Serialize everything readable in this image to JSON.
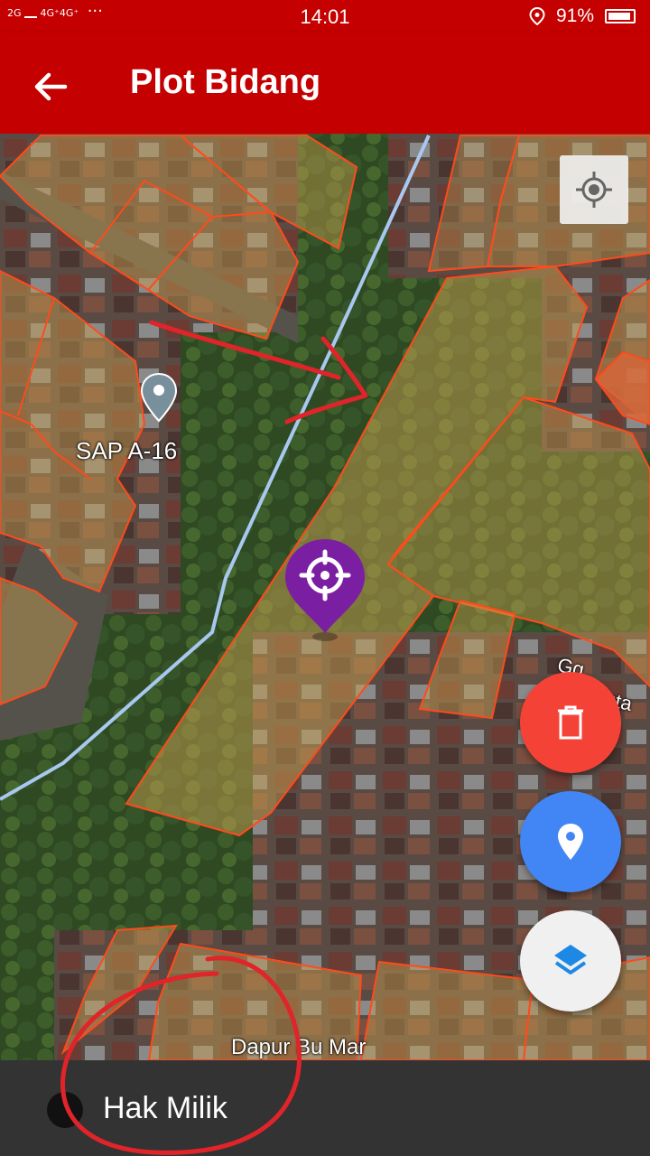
{
  "status_bar": {
    "network_left": "2G",
    "network_right": "4G⁺4G⁺",
    "more": "···",
    "time": "14:01",
    "battery": "91%",
    "battery_level": 0.91
  },
  "app_bar": {
    "title": "Plot Bidang",
    "back_icon": "arrow-back-icon"
  },
  "map": {
    "labels": {
      "poi": "SAP A-16",
      "street": "Gg. Rambuta",
      "place": "Dapur Bu Mar"
    },
    "colors": {
      "parcel_fill": "#c8a050",
      "parcel_stroke": "#ff4a1c",
      "road": "#a8c8f0",
      "pin": "#7b1fa2"
    }
  },
  "buttons": {
    "my_location": "my-location-icon",
    "delete": {
      "icon": "trash-icon",
      "color": "#f44336"
    },
    "add_marker": {
      "icon": "map-pin-icon",
      "color": "#4285f4"
    },
    "layers": {
      "icon": "layers-icon",
      "color": "#f0f0f0"
    }
  },
  "bottom": {
    "option_label": "Hak Milik"
  }
}
